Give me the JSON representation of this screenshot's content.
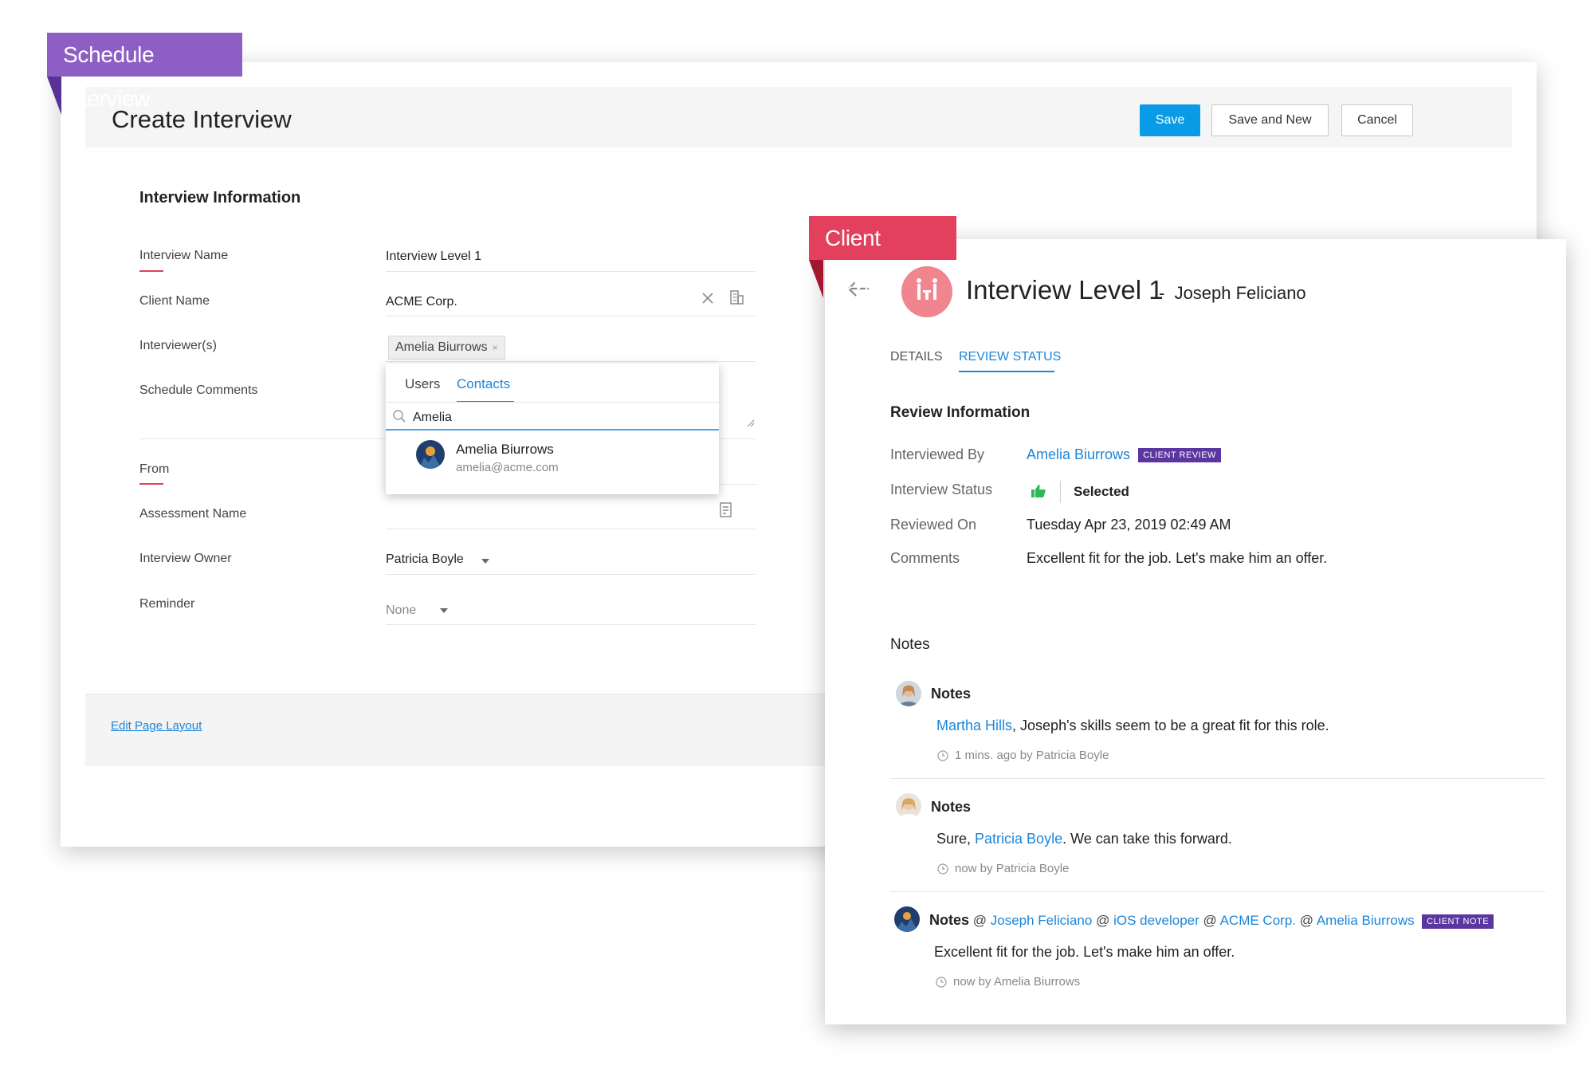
{
  "ribbons": {
    "schedule": "Schedule Interview",
    "review": "Client Review"
  },
  "create_form": {
    "title": "Create Interview",
    "buttons": {
      "save": "Save",
      "save_new": "Save and New",
      "cancel": "Cancel"
    },
    "section_title": "Interview Information",
    "fields": {
      "interview_name": {
        "label": "Interview Name",
        "value": "Interview Level 1"
      },
      "client_name": {
        "label": "Client Name",
        "value": "ACME Corp."
      },
      "interviewers": {
        "label": "Interviewer(s)",
        "chip": "Amelia Biurrows",
        "chip_remove": "×"
      },
      "schedule_comments": {
        "label": "Schedule Comments"
      },
      "from": {
        "label": "From"
      },
      "assessment_name": {
        "label": "Assessment Name"
      },
      "interview_owner": {
        "label": "Interview Owner",
        "value": "Patricia Boyle"
      },
      "reminder": {
        "label": "Reminder",
        "value": "None"
      }
    },
    "dropdown": {
      "tabs": [
        "Users",
        "Contacts"
      ],
      "active_tab": "Contacts",
      "search_value": "Amelia",
      "result": {
        "name": "Amelia Biurrows",
        "email": "amelia@acme.com"
      }
    },
    "footer_link": "Edit Page Layout"
  },
  "review": {
    "title": "Interview Level 1",
    "separator": "-",
    "candidate": "Joseph Feliciano",
    "tabs": [
      "DETAILS",
      "REVIEW STATUS"
    ],
    "active_tab": "REVIEW STATUS",
    "section_title": "Review Information",
    "rows": {
      "interviewed_by": {
        "label": "Interviewed By",
        "value": "Amelia Biurrows",
        "badge": "CLIENT REVIEW"
      },
      "status": {
        "label": "Interview Status",
        "value": "Selected"
      },
      "reviewed_on": {
        "label": "Reviewed On",
        "value": "Tuesday Apr 23, 2019 02:49 AM"
      },
      "comments": {
        "label": "Comments",
        "value": "Excellent fit for the job. Let's make him an offer."
      }
    },
    "notes_heading": "Notes",
    "notes": [
      {
        "title": "Notes",
        "mention": "Martha Hills",
        "text": ", Joseph's skills seem to be a great fit for this role.",
        "meta": "1 mins. ago  by  Patricia Boyle"
      },
      {
        "title": "Notes",
        "prefix": "Sure, ",
        "mention": "Patricia Boyle",
        "text": ". We can take this forward.",
        "meta": "now  by  Patricia Boyle"
      },
      {
        "title": "Notes",
        "tags": [
          "Joseph Feliciano",
          "iOS developer",
          "ACME Corp.",
          "Amelia Biurrows"
        ],
        "at": "@",
        "badge": "CLIENT NOTE",
        "text": "Excellent fit for the job. Let's make him an offer.",
        "meta": "now  by  Amelia Biurrows"
      }
    ]
  },
  "colors": {
    "accent_blue": "#1c86d9",
    "save_button": "#0a9be6",
    "ribbon_purple": "#8d5fc4",
    "ribbon_red": "#e2405c",
    "badge_purple": "#5b35a0",
    "selected_green": "#2eb85c"
  },
  "icons": [
    "close-icon",
    "building-icon",
    "search-icon",
    "document-icon",
    "resize-icon",
    "chevron-down-icon",
    "back-arrow-icon",
    "interview-icon",
    "thumbs-up-icon",
    "clock-icon"
  ]
}
